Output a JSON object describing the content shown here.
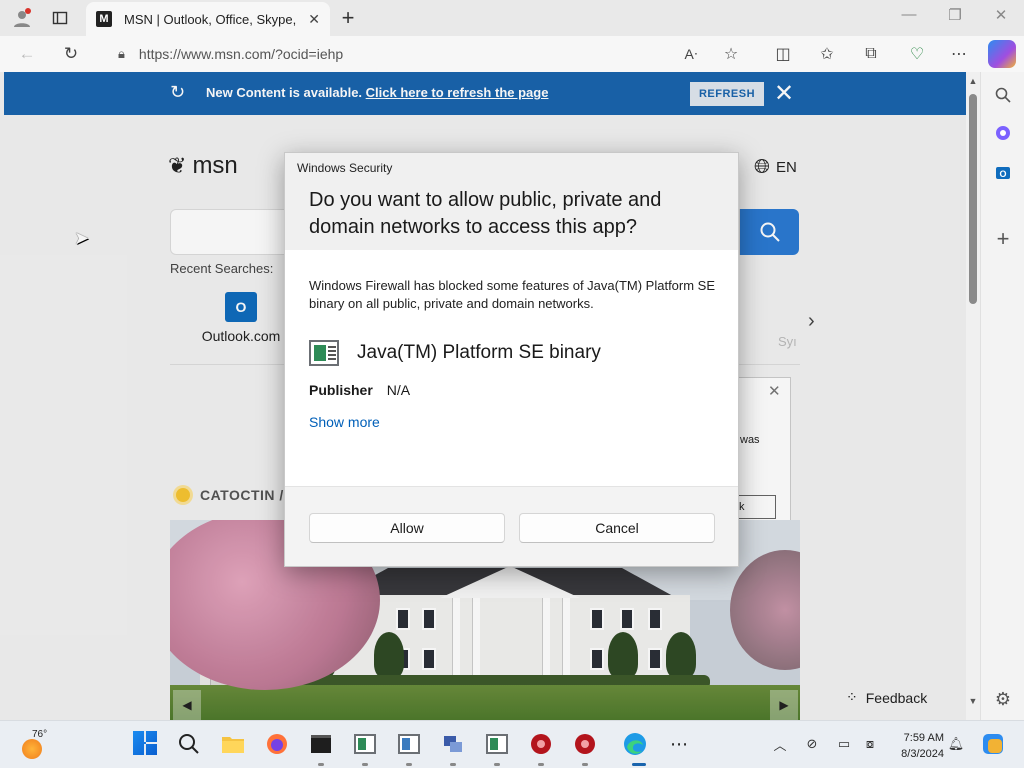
{
  "browser": {
    "tab_title": "MSN | Outlook, Office, Skype, Bing",
    "tab_favicon": "M",
    "url": "https://www.msn.com/?ocid=iehp"
  },
  "banner": {
    "message": "New Content is available. ",
    "link_text": "Click here to refresh the page",
    "refresh_label": "REFRESH",
    "color": "#1a64ad"
  },
  "page": {
    "logo_text": "msn",
    "language": "EN",
    "recent_label": "Recent Searches:",
    "tiles": [
      {
        "icon": "O",
        "label": "Outlook.com"
      }
    ],
    "partial_tile": "Syı",
    "bg_dialog_text": "was",
    "bg_dialog_button": "k",
    "weather_location": "CATOCTIN /",
    "feedback_label": "Feedback"
  },
  "dialog": {
    "app_title": "Windows Security",
    "heading": "Do you want to allow public, private and domain networks to access this app?",
    "description": "Windows Firewall has blocked some features of Java(TM) Platform SE binary on all public, private and domain networks.",
    "app_name": "Java(TM) Platform SE binary",
    "publisher_label": "Publisher",
    "publisher_value": "N/A",
    "show_more": "Show more",
    "allow_label": "Allow",
    "cancel_label": "Cancel"
  },
  "taskbar": {
    "temperature": "76°",
    "time": "7:59 AM",
    "date": "8/3/2024",
    "more_apps": "⋯"
  }
}
